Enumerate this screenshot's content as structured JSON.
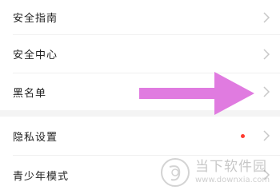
{
  "settings": {
    "items": [
      {
        "label": "安全指南"
      },
      {
        "label": "安全中心"
      },
      {
        "label": "黑名单"
      },
      {
        "label": "隐私设置",
        "has_red_dot": true
      },
      {
        "label": "青少年模式"
      }
    ]
  },
  "overlay": {
    "arrow_color": "#e07be0",
    "points_to": "黑名单"
  },
  "watermark": {
    "name": "当下软件园",
    "url": "www.downxia.com"
  },
  "colors": {
    "background": "#ffffff",
    "section_gap": "#f4f4f4",
    "text": "#222222",
    "chevron": "#c8c8c8",
    "red_dot": "#ff3b30"
  }
}
